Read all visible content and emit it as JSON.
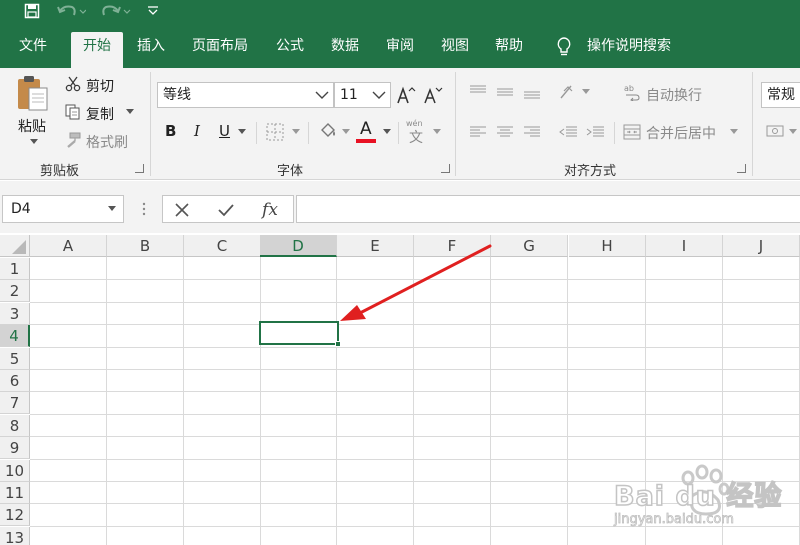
{
  "titlebar": {
    "bg": "#217346",
    "icons": [
      "save-icon",
      "undo-icon",
      "redo-icon",
      "customize-qat-icon"
    ]
  },
  "menu": {
    "tabs": [
      "文件",
      "开始",
      "插入",
      "页面布局",
      "公式",
      "数据",
      "审阅",
      "视图",
      "帮助"
    ],
    "active_tab": "开始",
    "tell_me": "操作说明搜索"
  },
  "ribbon": {
    "clipboard": {
      "paste": "粘贴",
      "cut": "剪切",
      "copy": "复制",
      "format_painter": "格式刷",
      "label": "剪贴板"
    },
    "font": {
      "font_name": "等线",
      "font_size": "11",
      "bold": "B",
      "italic": "I",
      "underline": "U",
      "font_color_glyph": "A",
      "font_color": "#e81123",
      "phonetic_glyph": "wén",
      "phonetic_char": "文",
      "label": "字体"
    },
    "alignment": {
      "wrap_text": "自动换行",
      "merge_center": "合并后居中",
      "label": "对齐方式"
    },
    "number": {
      "format": "常规"
    }
  },
  "formula_bar": {
    "name_box": "D4",
    "formula": ""
  },
  "sheet": {
    "columns": [
      "A",
      "B",
      "C",
      "D",
      "E",
      "F",
      "G",
      "H",
      "I",
      "J"
    ],
    "rows": [
      "1",
      "2",
      "3",
      "4",
      "5",
      "6",
      "7",
      "8",
      "9",
      "10",
      "11",
      "12",
      "13"
    ],
    "active_column": "D",
    "active_row": "4",
    "accent": "#217346"
  },
  "annotation": {
    "arrow_color": "#e02020"
  },
  "watermark": {
    "brand": "Bai du 经验",
    "url": "jingyan.baidu.com"
  }
}
